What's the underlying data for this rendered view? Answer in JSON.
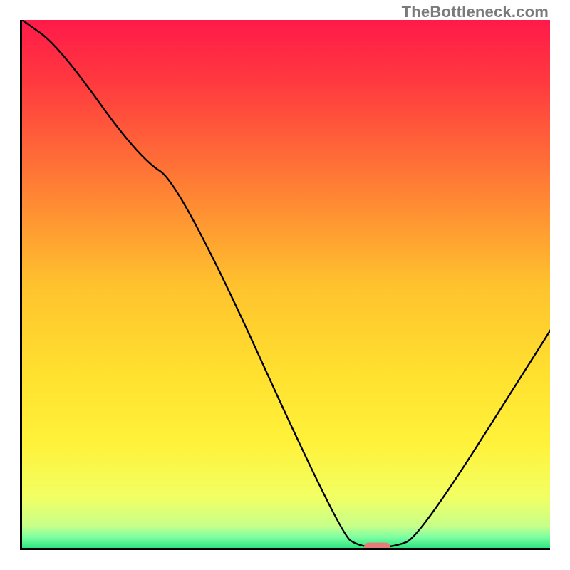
{
  "watermark": "TheBottleneck.com",
  "chart_data": {
    "type": "line",
    "title": "",
    "xlabel": "",
    "ylabel": "",
    "xlim": [
      0,
      100
    ],
    "ylim": [
      0,
      100
    ],
    "grid": false,
    "legend": null,
    "background_gradient_stops": [
      {
        "pct": 0,
        "color": "#ff1a49"
      },
      {
        "pct": 12,
        "color": "#ff3a3f"
      },
      {
        "pct": 30,
        "color": "#ff7a35"
      },
      {
        "pct": 50,
        "color": "#ffc22e"
      },
      {
        "pct": 67,
        "color": "#ffe12f"
      },
      {
        "pct": 80,
        "color": "#fff23b"
      },
      {
        "pct": 90,
        "color": "#f2ff63"
      },
      {
        "pct": 95.5,
        "color": "#c6ff8a"
      },
      {
        "pct": 97.5,
        "color": "#7fffa2"
      },
      {
        "pct": 100,
        "color": "#1fe07a"
      }
    ],
    "series": [
      {
        "name": "bottleneck-curve",
        "color": "#000000",
        "x": [
          0,
          7,
          22,
          30,
          60,
          64,
          70,
          75,
          100
        ],
        "y": [
          100,
          95,
          74,
          69,
          3,
          0.5,
          0.5,
          2.5,
          42
        ]
      }
    ],
    "marker": {
      "name": "optimal-marker",
      "shape": "rounded-rect",
      "color": "#e97a7a",
      "x": 67,
      "y": 0.5,
      "width_pct": 5,
      "height_pct": 1.8
    }
  }
}
